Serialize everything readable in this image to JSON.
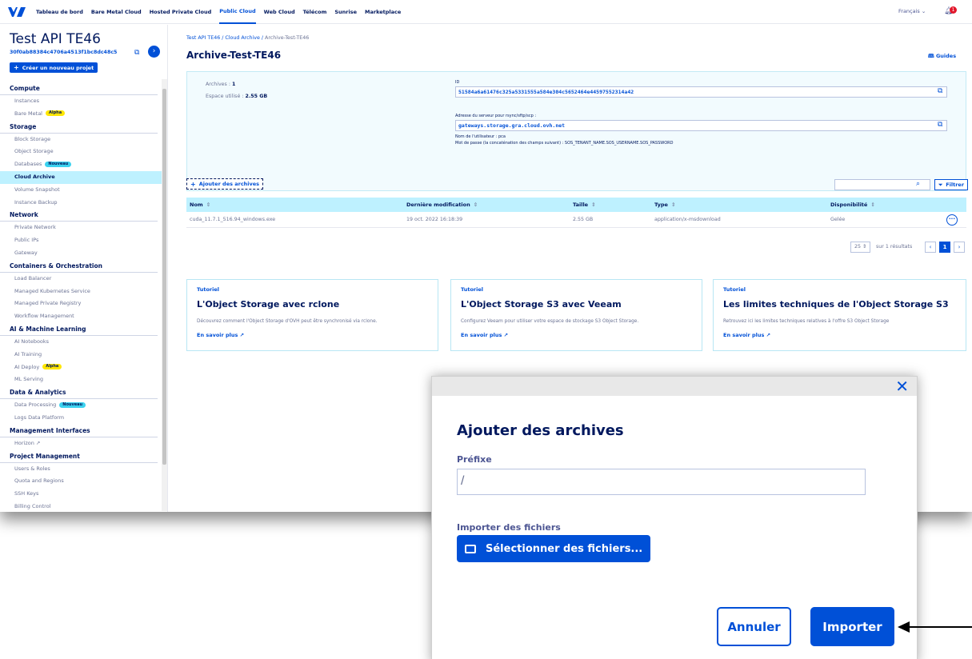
{
  "topnav": {
    "links": [
      "Tableau de bord",
      "Bare Metal Cloud",
      "Hosted Private Cloud",
      "Public Cloud",
      "Web Cloud",
      "Télécom",
      "Sunrise",
      "Marketplace"
    ],
    "active_index": 3,
    "language": "Français",
    "notification_count": "1"
  },
  "sidebar": {
    "project_title": "Test API TE46",
    "project_id": "30f0ab88384c4706a4513f1bc8dc48c5",
    "new_project_label": "Créer un nouveau projet",
    "sections": [
      {
        "title": "Compute",
        "items": [
          {
            "label": "Instances"
          },
          {
            "label": "Bare Metal",
            "badge": "Alpha"
          }
        ]
      },
      {
        "title": "Storage",
        "items": [
          {
            "label": "Block Storage"
          },
          {
            "label": "Object Storage"
          },
          {
            "label": "Databases",
            "badge": "Nouveau"
          },
          {
            "label": "Cloud Archive",
            "selected": true
          },
          {
            "label": "Volume Snapshot"
          },
          {
            "label": "Instance Backup"
          }
        ]
      },
      {
        "title": "Network",
        "items": [
          {
            "label": "Private Network"
          },
          {
            "label": "Public IPs"
          },
          {
            "label": "Gateway"
          }
        ]
      },
      {
        "title": "Containers & Orchestration",
        "items": [
          {
            "label": "Load Balancer"
          },
          {
            "label": "Managed Kubernetes Service"
          },
          {
            "label": "Managed Private Registry"
          },
          {
            "label": "Workflow Management"
          }
        ]
      },
      {
        "title": "AI & Machine Learning",
        "items": [
          {
            "label": "AI Notebooks"
          },
          {
            "label": "AI Training"
          },
          {
            "label": "AI Deploy",
            "badge": "Alpha"
          },
          {
            "label": "ML Serving"
          }
        ]
      },
      {
        "title": "Data & Analytics",
        "items": [
          {
            "label": "Data Processing",
            "badge": "Nouveau"
          },
          {
            "label": "Logs Data Platform"
          }
        ]
      },
      {
        "title": "Management Interfaces",
        "items": [
          {
            "label": "Horizon ↗"
          }
        ]
      },
      {
        "title": "Project Management",
        "items": [
          {
            "label": "Users & Roles"
          },
          {
            "label": "Quota and Regions"
          },
          {
            "label": "SSH Keys"
          },
          {
            "label": "Billing Control"
          }
        ]
      }
    ]
  },
  "main": {
    "breadcrumb": {
      "part1": "Test API TE46",
      "part2": "Cloud Archive",
      "current": "Archive-Test-TE46",
      "sep": " / "
    },
    "title": "Archive-Test-TE46",
    "guides_label": "Guides",
    "info": {
      "archives_label": "Archives :",
      "archives_value": "1",
      "space_label": "Espace utilisé :",
      "space_value": "2.55 GB",
      "id_label": "ID",
      "id_value": "51584a6a61476c325a5331555a584e304c5652464e44597552314a42",
      "server_label": "Adresse du serveur pour rsync/sftp/scp :",
      "server_value": "gateways.storage.gra.cloud.ovh.net",
      "user_label": "Nom de l'utilisateur : pca",
      "password_label": "Mot de passe (la concaténation des champs suivant) : SOS_TENANT_NAME.SOS_USERNAME.SOS_PASSWORD"
    },
    "add_archives_label": "Ajouter des archives",
    "filter_label": "Filtrer",
    "table": {
      "columns": [
        "Nom",
        "Dernière modification",
        "Taille",
        "Type",
        "Disponibilité"
      ],
      "rows": [
        [
          "cuda_11.7.1_516.94_windows.exe",
          "19 oct. 2022 16:18:39",
          "2.55 GB",
          "application/x-msdownload",
          "Gelée"
        ]
      ]
    },
    "pager": {
      "page_size": "25",
      "results_text": "sur 1 résultats",
      "current_page": "1"
    },
    "cards": [
      {
        "kicker": "Tutoriel",
        "title": "L'Object Storage avec rclone",
        "desc": "Découvrez comment l'Object Storage d'OVH peut être synchronisé via rclone.",
        "link": "En savoir plus"
      },
      {
        "kicker": "Tutoriel",
        "title": "L'Object Storage S3 avec Veeam",
        "desc": "Configurez Veeam pour utiliser votre espace de stockage S3 Object Storage.",
        "link": "En savoir plus"
      },
      {
        "kicker": "Tutoriel",
        "title": "Les limites techniques de l'Object Storage S3",
        "desc": "Retrouvez ici les limites techniques relatives à l'offre S3 Object Storage",
        "link": "En savoir plus"
      }
    ]
  },
  "modal": {
    "title": "Ajouter des archives",
    "prefix_label": "Préfixe",
    "prefix_value": "/",
    "import_label": "Importer des fichiers",
    "select_files_label": "Sélectionner des fichiers...",
    "cancel_label": "Annuler",
    "import_button_label": "Importer"
  },
  "colors": {
    "brand": "#0050d7",
    "navy": "#00185e",
    "highlight": "#bef1ff",
    "alert": "#e2162a"
  }
}
